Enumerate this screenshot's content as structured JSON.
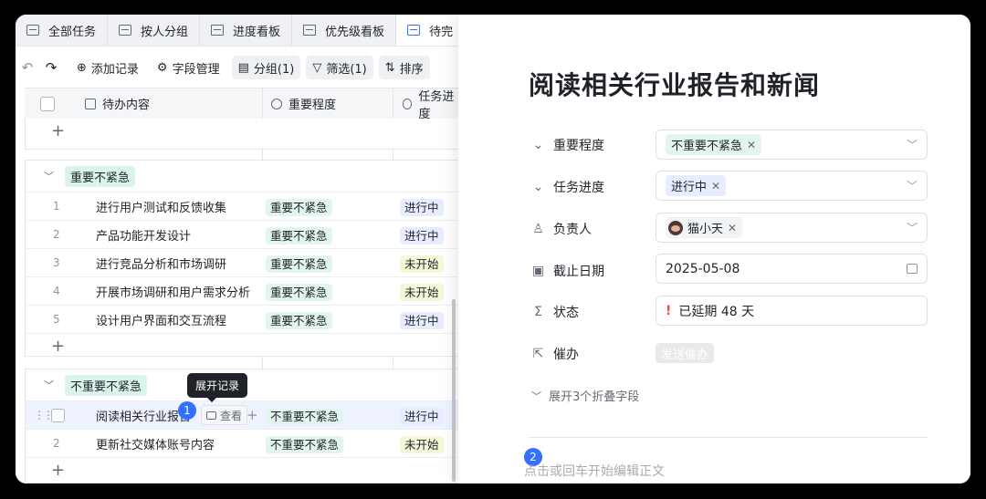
{
  "tabs": [
    {
      "label": "全部任务",
      "icon": "table-icon"
    },
    {
      "label": "按人分组",
      "icon": "table-icon"
    },
    {
      "label": "进度看板",
      "icon": "kanban-icon"
    },
    {
      "label": "优先级看板",
      "icon": "kanban-icon"
    },
    {
      "label": "待完",
      "icon": "table-icon",
      "active": true
    }
  ],
  "toolbar": {
    "undo": "↶",
    "redo": "↷",
    "add_record": "添加记录",
    "field_manage": "字段管理",
    "group": "分组(1)",
    "filter": "筛选(1)",
    "sort": "排序"
  },
  "table": {
    "headers": {
      "todo": "待办内容",
      "importance": "重要程度",
      "progress": "任务进度"
    },
    "groups": [
      {
        "label": "重要不紧急",
        "tag_color": "#d9f5eb",
        "rows": [
          {
            "num": "1",
            "text": "进行用户测试和反馈收集",
            "importance": "重要不紧急",
            "progress": "进行中"
          },
          {
            "num": "2",
            "text": "产品功能开发设计",
            "importance": "重要不紧急",
            "progress": "进行中"
          },
          {
            "num": "3",
            "text": "进行竞品分析和市场调研",
            "importance": "重要不紧急",
            "progress": "未开始"
          },
          {
            "num": "4",
            "text": "开展市场调研和用户需求分析",
            "importance": "重要不紧急",
            "progress": "未开始"
          },
          {
            "num": "5",
            "text": "设计用户界面和交互流程",
            "importance": "重要不紧急",
            "progress": "进行中"
          }
        ]
      },
      {
        "label": "不重要不紧急",
        "tag_color": "#d9f5eb",
        "rows": [
          {
            "num": "",
            "text": "阅读相关行业报告",
            "importance": "不重要不紧急",
            "progress": "进行中",
            "view": "查看"
          },
          {
            "num": "2",
            "text": "更新社交媒体账号内容",
            "importance": "不重要不紧急",
            "progress": "未开始"
          }
        ]
      }
    ],
    "tooltip": "展开记录",
    "badge1": "1"
  },
  "colors": {
    "importance_bg": "#e3f5ef",
    "in_progress_bg": "#e8ecff",
    "not_started_bg": "#f5f7d6",
    "accent": "#3370ff"
  },
  "detail": {
    "title": "阅读相关行业报告和新闻",
    "fields": {
      "importance": {
        "label": "重要程度",
        "value": "不重要不紧急"
      },
      "progress": {
        "label": "任务进度",
        "value": "进行中"
      },
      "owner": {
        "label": "负责人",
        "value": "猫小天"
      },
      "due": {
        "label": "截止日期",
        "value": "2025-05-08"
      },
      "status": {
        "label": "状态",
        "mark": "!",
        "value": "已延期 48 天"
      },
      "remind": {
        "label": "催办",
        "button": "发送催办"
      }
    },
    "expand": "展开3个折叠字段",
    "badge2": "2",
    "body_placeholder": "点击或回车开始编辑正文"
  }
}
